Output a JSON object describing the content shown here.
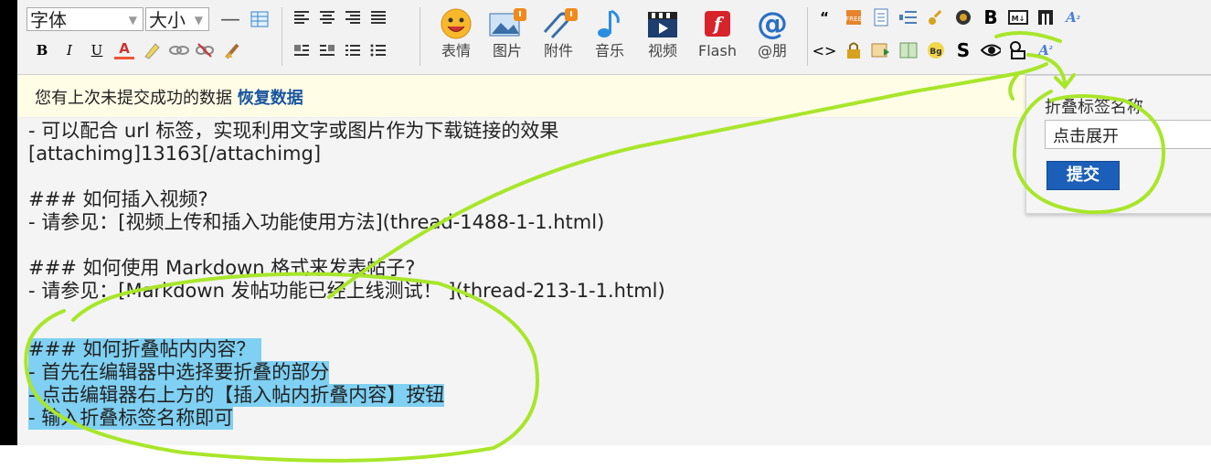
{
  "toolbar": {
    "font_select": "字体",
    "size_select": "大小",
    "big_buttons": [
      "表情",
      "图片",
      "附件",
      "音乐",
      "视频",
      "Flash",
      "@朋"
    ],
    "format_row2": [
      "B",
      "I",
      "U",
      "A"
    ]
  },
  "notice": {
    "text": "您有上次未提交成功的数据",
    "link": "恢复数据"
  },
  "editor": {
    "lines": [
      "- 可以配合 url 标签，实现利用文字或图片作为下载链接的效果",
      "[attachimg]13163[/attachimg]",
      "",
      "### 如何插入视频?",
      "- 请参见：[视频上传和插入功能使用方法](thread-1488-1-1.html)",
      "",
      "### 如何使用 Markdown 格式来发表帖子?",
      "- 请参见：[Markdown 发帖功能已经上线测试！ ](thread-213-1-1.html)",
      "",
      "### 如何折叠帖内内容？ ",
      "- 首先在编辑器中选择要折叠的部分",
      "- 点击编辑器右上方的【插入帖内折叠内容】按钮",
      "- 输入折叠标签名称即可"
    ]
  },
  "popup": {
    "label": "折叠标签名称",
    "input_value": "点击展开",
    "submit": "提交"
  },
  "colors": {
    "highlight": "#7fd0f2",
    "annotation": "#a8e62a",
    "link": "#1a56a0"
  }
}
